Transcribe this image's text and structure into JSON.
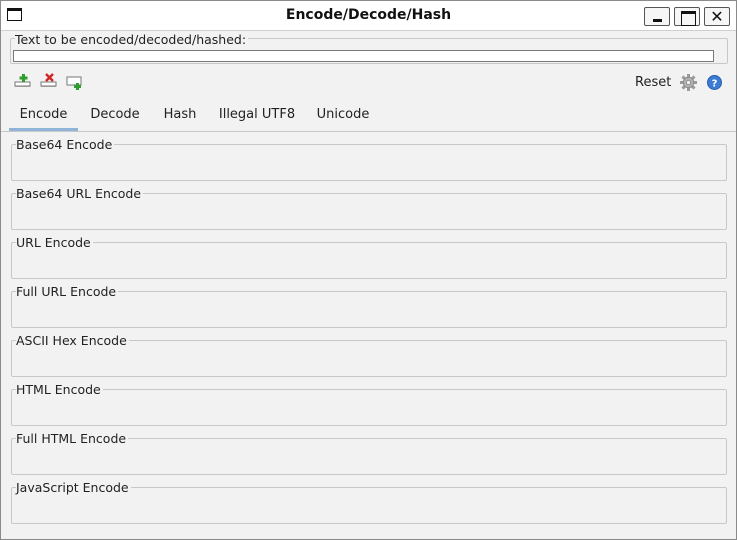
{
  "window": {
    "title": "Encode/Decode/Hash",
    "close_glyph": "✕"
  },
  "input": {
    "label": "Text to be encoded/decoded/hashed:",
    "value": ""
  },
  "toolbar": {
    "icons": [
      "add-tab-icon",
      "remove-tab-icon",
      "add-output-icon"
    ],
    "reset_label": "Reset",
    "settings_icon": "gear-icon",
    "help_icon": "help-icon"
  },
  "tabs": [
    {
      "label": "Encode",
      "active": true
    },
    {
      "label": "Decode",
      "active": false
    },
    {
      "label": "Hash",
      "active": false
    },
    {
      "label": "Illegal UTF8",
      "active": false
    },
    {
      "label": "Unicode",
      "active": false
    }
  ],
  "sections": [
    {
      "label": "Base64 Encode",
      "value": ""
    },
    {
      "label": "Base64 URL Encode",
      "value": ""
    },
    {
      "label": "URL Encode",
      "value": ""
    },
    {
      "label": "Full URL Encode",
      "value": ""
    },
    {
      "label": "ASCII Hex Encode",
      "value": ""
    },
    {
      "label": "HTML Encode",
      "value": ""
    },
    {
      "label": "Full HTML Encode",
      "value": ""
    },
    {
      "label": "JavaScript Encode",
      "value": ""
    }
  ],
  "colors": {
    "active_tab_underline": "#8fb4d8",
    "add_green": "#2e9e2e",
    "remove_red": "#d22424",
    "help_blue": "#3a7bd5"
  }
}
